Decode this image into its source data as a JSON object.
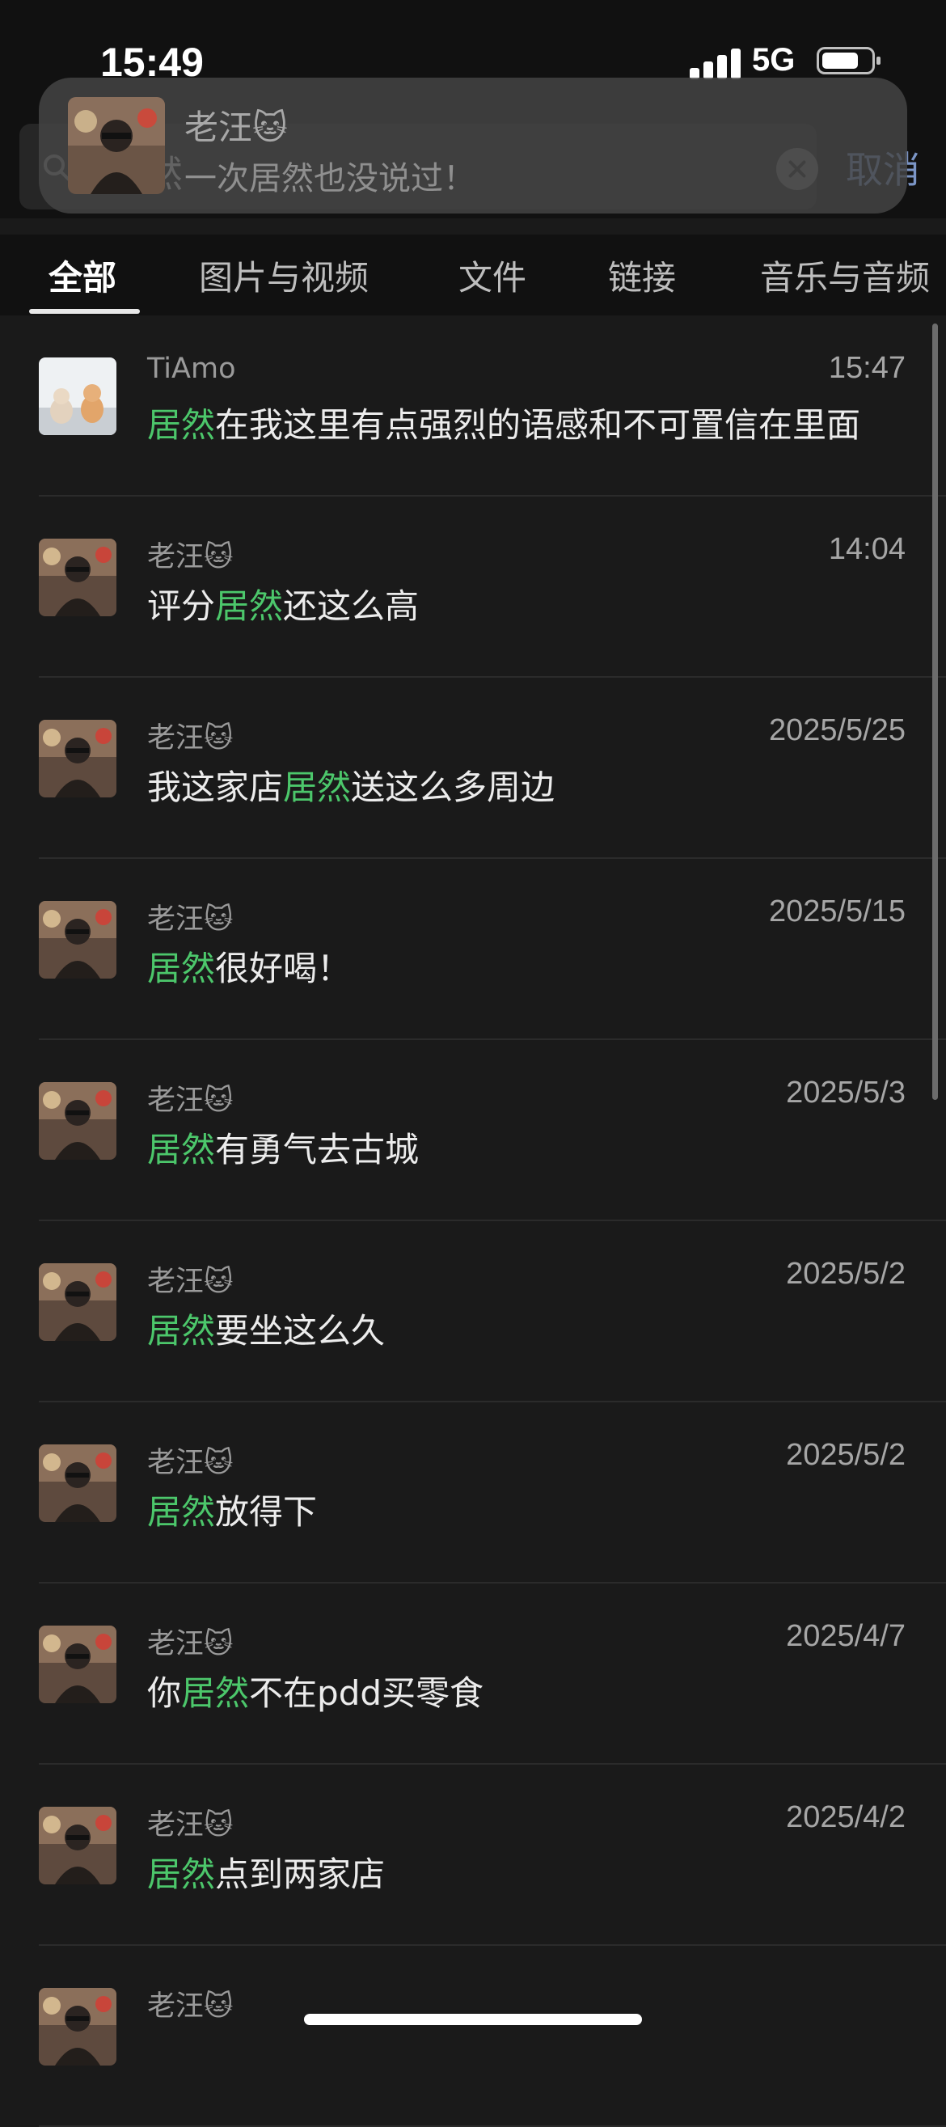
{
  "status_bar": {
    "time": "15:49",
    "network": "5G"
  },
  "search": {
    "query": "居然",
    "cancel_label": "取消"
  },
  "notification": {
    "sender": "老汪🐱",
    "message": "一次居然也没说过！"
  },
  "tabs": [
    "全部",
    "图片与视频",
    "文件",
    "链接",
    "音乐与音频"
  ],
  "results": [
    {
      "sender": "TiAmo",
      "date": "15:47",
      "before": "",
      "highlight": "居然",
      "after": "在我这里有点强烈的语感和不可置信在里面",
      "avatar": "cats"
    },
    {
      "sender": "老汪🐱",
      "date": "14:04",
      "before": "评分",
      "highlight": "居然",
      "after": "还这么高",
      "avatar": "person"
    },
    {
      "sender": "老汪🐱",
      "date": "2025/5/25",
      "before": "我这家店",
      "highlight": "居然",
      "after": "送这么多周边",
      "avatar": "person"
    },
    {
      "sender": "老汪🐱",
      "date": "2025/5/15",
      "before": "",
      "highlight": "居然",
      "after": "很好喝！",
      "avatar": "person"
    },
    {
      "sender": "老汪🐱",
      "date": "2025/5/3",
      "before": "",
      "highlight": "居然",
      "after": "有勇气去古城",
      "avatar": "person"
    },
    {
      "sender": "老汪🐱",
      "date": "2025/5/2",
      "before": "",
      "highlight": "居然",
      "after": "要坐这么久",
      "avatar": "person"
    },
    {
      "sender": "老汪🐱",
      "date": "2025/5/2",
      "before": "",
      "highlight": "居然",
      "after": "放得下",
      "avatar": "person"
    },
    {
      "sender": "老汪🐱",
      "date": "2025/4/7",
      "before": "你",
      "highlight": "居然",
      "after": "不在pdd买零食",
      "avatar": "person"
    },
    {
      "sender": "老汪🐱",
      "date": "2025/4/2",
      "before": "",
      "highlight": "居然",
      "after": "点到两家店",
      "avatar": "person"
    },
    {
      "sender": "老汪🐱",
      "date": "",
      "before": "",
      "highlight": "",
      "after": "",
      "avatar": "person"
    }
  ],
  "colors": {
    "highlight": "#4cc76b",
    "cancel": "#7b95c6",
    "background": "#1a1a1a"
  }
}
